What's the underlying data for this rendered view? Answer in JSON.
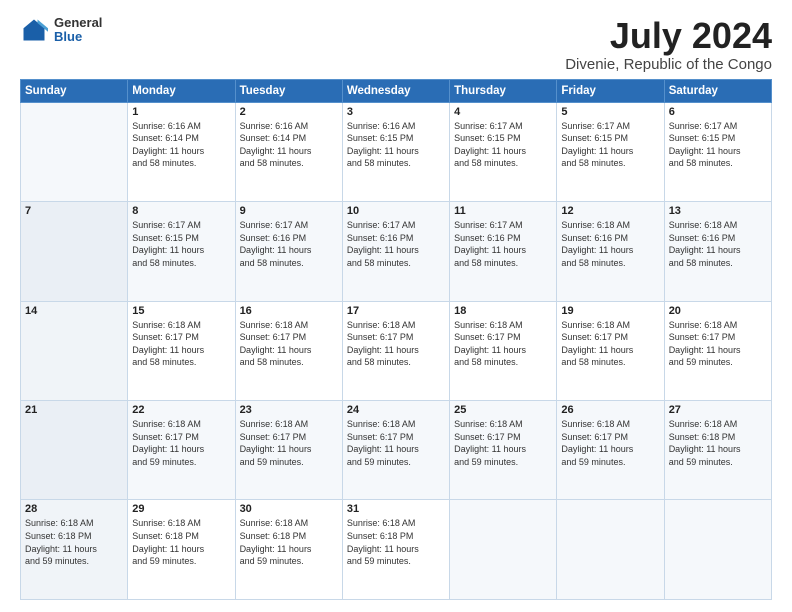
{
  "header": {
    "logo": {
      "general": "General",
      "blue": "Blue"
    },
    "title": "July 2024",
    "location": "Divenie, Republic of the Congo"
  },
  "calendar": {
    "columns": [
      "Sunday",
      "Monday",
      "Tuesday",
      "Wednesday",
      "Thursday",
      "Friday",
      "Saturday"
    ],
    "weeks": [
      [
        {
          "day": "",
          "info": ""
        },
        {
          "day": "1",
          "info": "Sunrise: 6:16 AM\nSunset: 6:14 PM\nDaylight: 11 hours\nand 58 minutes."
        },
        {
          "day": "2",
          "info": "Sunrise: 6:16 AM\nSunset: 6:14 PM\nDaylight: 11 hours\nand 58 minutes."
        },
        {
          "day": "3",
          "info": "Sunrise: 6:16 AM\nSunset: 6:15 PM\nDaylight: 11 hours\nand 58 minutes."
        },
        {
          "day": "4",
          "info": "Sunrise: 6:17 AM\nSunset: 6:15 PM\nDaylight: 11 hours\nand 58 minutes."
        },
        {
          "day": "5",
          "info": "Sunrise: 6:17 AM\nSunset: 6:15 PM\nDaylight: 11 hours\nand 58 minutes."
        },
        {
          "day": "6",
          "info": "Sunrise: 6:17 AM\nSunset: 6:15 PM\nDaylight: 11 hours\nand 58 minutes."
        }
      ],
      [
        {
          "day": "7",
          "info": ""
        },
        {
          "day": "8",
          "info": "Sunrise: 6:17 AM\nSunset: 6:15 PM\nDaylight: 11 hours\nand 58 minutes."
        },
        {
          "day": "9",
          "info": "Sunrise: 6:17 AM\nSunset: 6:16 PM\nDaylight: 11 hours\nand 58 minutes."
        },
        {
          "day": "10",
          "info": "Sunrise: 6:17 AM\nSunset: 6:16 PM\nDaylight: 11 hours\nand 58 minutes."
        },
        {
          "day": "11",
          "info": "Sunrise: 6:17 AM\nSunset: 6:16 PM\nDaylight: 11 hours\nand 58 minutes."
        },
        {
          "day": "12",
          "info": "Sunrise: 6:18 AM\nSunset: 6:16 PM\nDaylight: 11 hours\nand 58 minutes."
        },
        {
          "day": "13",
          "info": "Sunrise: 6:18 AM\nSunset: 6:16 PM\nDaylight: 11 hours\nand 58 minutes."
        }
      ],
      [
        {
          "day": "14",
          "info": ""
        },
        {
          "day": "15",
          "info": "Sunrise: 6:18 AM\nSunset: 6:17 PM\nDaylight: 11 hours\nand 58 minutes."
        },
        {
          "day": "16",
          "info": "Sunrise: 6:18 AM\nSunset: 6:17 PM\nDaylight: 11 hours\nand 58 minutes."
        },
        {
          "day": "17",
          "info": "Sunrise: 6:18 AM\nSunset: 6:17 PM\nDaylight: 11 hours\nand 58 minutes."
        },
        {
          "day": "18",
          "info": "Sunrise: 6:18 AM\nSunset: 6:17 PM\nDaylight: 11 hours\nand 58 minutes."
        },
        {
          "day": "19",
          "info": "Sunrise: 6:18 AM\nSunset: 6:17 PM\nDaylight: 11 hours\nand 58 minutes."
        },
        {
          "day": "20",
          "info": "Sunrise: 6:18 AM\nSunset: 6:17 PM\nDaylight: 11 hours\nand 59 minutes."
        }
      ],
      [
        {
          "day": "21",
          "info": ""
        },
        {
          "day": "22",
          "info": "Sunrise: 6:18 AM\nSunset: 6:17 PM\nDaylight: 11 hours\nand 59 minutes."
        },
        {
          "day": "23",
          "info": "Sunrise: 6:18 AM\nSunset: 6:17 PM\nDaylight: 11 hours\nand 59 minutes."
        },
        {
          "day": "24",
          "info": "Sunrise: 6:18 AM\nSunset: 6:17 PM\nDaylight: 11 hours\nand 59 minutes."
        },
        {
          "day": "25",
          "info": "Sunrise: 6:18 AM\nSunset: 6:17 PM\nDaylight: 11 hours\nand 59 minutes."
        },
        {
          "day": "26",
          "info": "Sunrise: 6:18 AM\nSunset: 6:17 PM\nDaylight: 11 hours\nand 59 minutes."
        },
        {
          "day": "27",
          "info": "Sunrise: 6:18 AM\nSunset: 6:18 PM\nDaylight: 11 hours\nand 59 minutes."
        }
      ],
      [
        {
          "day": "28",
          "info": "Sunrise: 6:18 AM\nSunset: 6:18 PM\nDaylight: 11 hours\nand 59 minutes."
        },
        {
          "day": "29",
          "info": "Sunrise: 6:18 AM\nSunset: 6:18 PM\nDaylight: 11 hours\nand 59 minutes."
        },
        {
          "day": "30",
          "info": "Sunrise: 6:18 AM\nSunset: 6:18 PM\nDaylight: 11 hours\nand 59 minutes."
        },
        {
          "day": "31",
          "info": "Sunrise: 6:18 AM\nSunset: 6:18 PM\nDaylight: 11 hours\nand 59 minutes."
        },
        {
          "day": "",
          "info": ""
        },
        {
          "day": "",
          "info": ""
        },
        {
          "day": "",
          "info": ""
        }
      ]
    ]
  }
}
